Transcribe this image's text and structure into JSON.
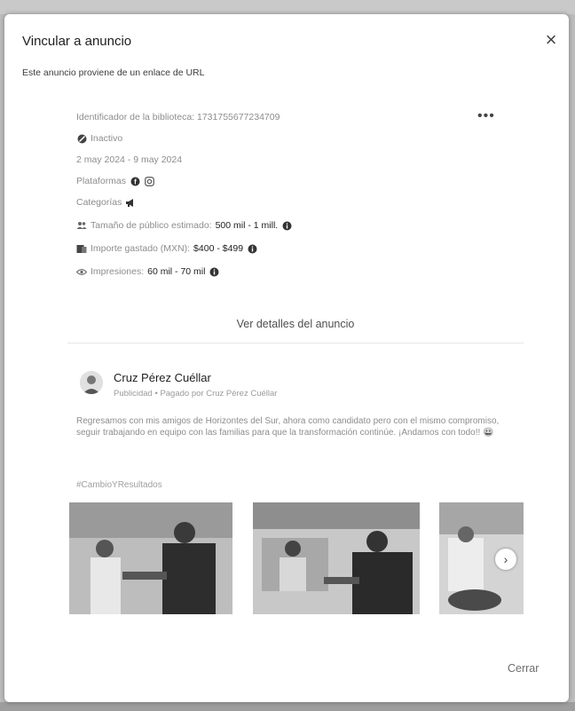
{
  "dialog": {
    "title": "Vincular a anuncio",
    "subtitle": "Este anuncio proviene de un enlace de URL",
    "close_label": "×",
    "footer_button": "Cerrar"
  },
  "ad": {
    "library_id": "Identificador de la biblioteca: 1731755677234709",
    "more_label": "•••",
    "status": "Inactivo",
    "dates": "2 may 2024 - 9 may 2024",
    "platforms_label": "Plataformas",
    "categories_label": "Categorías",
    "audience_label": "Tamaño de público estimado:",
    "audience_value": "500 mil - 1 mill.",
    "spend_label": "Importe gastado (MXN):",
    "spend_value": "$400 - $499",
    "impressions_label": "Impresiones:",
    "impressions_value": "60 mil - 70 mil",
    "details_button": "Ver detalles del anuncio"
  },
  "post": {
    "author": "Cruz Pérez Cuéllar",
    "meta": "Publicidad • Pagado por Cruz Pérez Cuéllar",
    "body": "Regresamos con mis amigos de Horizontes del Sur, ahora como candidato pero con el mismo compromiso, seguir trabajando en equipo con las familias para que la transformación continúe. ¡Andamos con todo!! 😀",
    "hashtag": "#CambioYResultados",
    "next_label": "›"
  },
  "colors": {
    "accent_text": "#1c1e21",
    "muted_text": "#8a8d91",
    "divider": "#e4e6eb"
  },
  "icons": [
    "close-icon",
    "more-icon",
    "inactive-status-icon",
    "facebook-icon",
    "instagram-icon",
    "megaphone-icon",
    "audience-icon",
    "spend-icon",
    "impressions-icon",
    "info-icon",
    "chevron-right-icon"
  ]
}
